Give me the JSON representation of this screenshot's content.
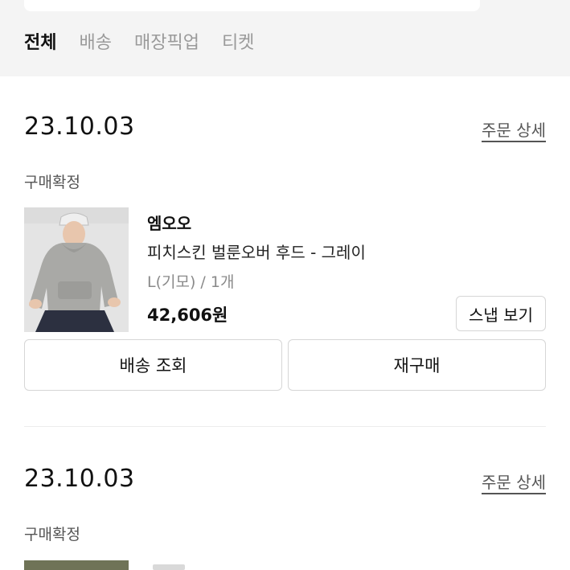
{
  "tabs": [
    {
      "label": "전체",
      "active": true
    },
    {
      "label": "배송",
      "active": false
    },
    {
      "label": "매장픽업",
      "active": false
    },
    {
      "label": "티켓",
      "active": false
    }
  ],
  "orders": [
    {
      "date": "23.10.03",
      "detail_link": "주문 상세",
      "status": "구매확정",
      "brand": "엠오오",
      "product_name": "피치스킨 벌룬오버 후드 - 그레이",
      "option": "L(기모) / 1개",
      "price": "42,606원",
      "snap_button": "스냅 보기",
      "delivery_button": "배송 조회",
      "rebuy_button": "재구매"
    },
    {
      "date": "23.10.03",
      "detail_link": "주문 상세",
      "status": "구매확정"
    }
  ]
}
